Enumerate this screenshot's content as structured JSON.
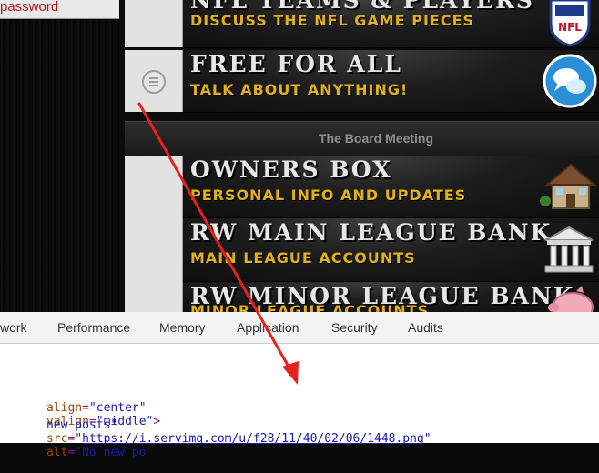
{
  "forum": {
    "password_link": "password",
    "forums": [
      {
        "title": "NFL TEAMS & PLAYERS",
        "subtitle": "DISCUSS THE NFL GAME PIECES",
        "icon": "nfl-shield-icon"
      },
      {
        "title": "FREE FOR ALL",
        "subtitle": "TALK ABOUT ANYTHING!",
        "icon": "chat-bubble-icon"
      },
      {
        "title": "OWNERS BOX",
        "subtitle": "PERSONAL INFO AND UPDATES",
        "icon": "house-icon"
      },
      {
        "title": "RW MAIN LEAGUE BANK",
        "subtitle": "MAIN LEAGUE ACCOUNTS",
        "icon": "bank-icon"
      },
      {
        "title": "RW MINOR LEAGUE BANK",
        "subtitle": "MINOR LEAGUE ACCOUNTS",
        "icon": "piggy-bank-icon"
      }
    ],
    "category": "The Board Meeting",
    "status_icon": "no-new-posts-icon"
  },
  "devtools": {
    "tabs": [
      "work",
      "Performance",
      "Memory",
      "Application",
      "Security",
      "Audits"
    ],
    "code": {
      "line1": {
        "attr1": "align",
        "val1": "\"center\"",
        "attr2": "valign",
        "val2": "\"middle\"",
        "close": ">"
      },
      "line2": {
        "lead": "new posts\"",
        "attr_src": "src",
        "url": "https://i.servimg.com/u/f28/11/40/02/06/1448.png",
        "attr_alt": "alt",
        "alt_val": "\"No new po"
      }
    }
  },
  "colors": {
    "banner_title": "#e6e6e6",
    "banner_subtitle": "#e2b11a",
    "password_text": "#b21818",
    "annotation_arrow": "#e8201c"
  }
}
